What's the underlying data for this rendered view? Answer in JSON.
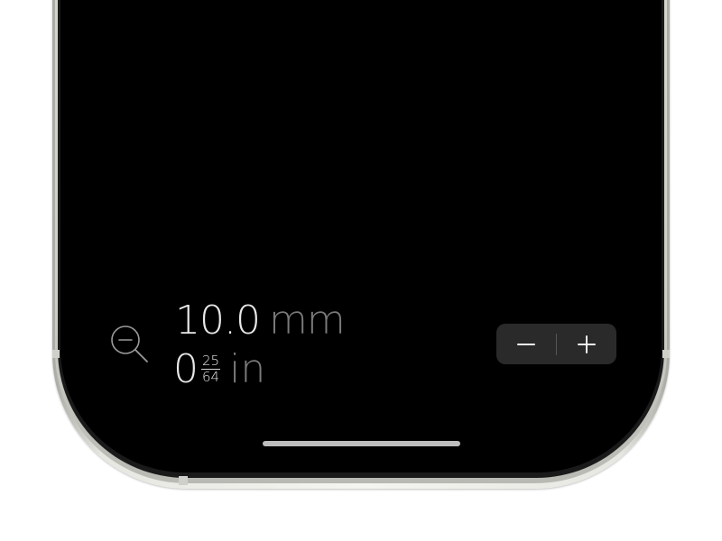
{
  "readout": {
    "mm_value": "10.0",
    "mm_unit": "mm",
    "in_whole": "0",
    "in_fraction_numerator": "25",
    "in_fraction_denominator": "64",
    "in_unit": "in"
  },
  "icons": {
    "zoom": "zoom-out-icon",
    "decrement": "minus-icon",
    "increment": "plus-icon"
  },
  "colors": {
    "screen": "#000000",
    "primary_text": "#e8e8e8",
    "unit_text": "#7a7a7a",
    "stepper_bg": "#2a2a2a",
    "frame": "#e7e7e2"
  }
}
